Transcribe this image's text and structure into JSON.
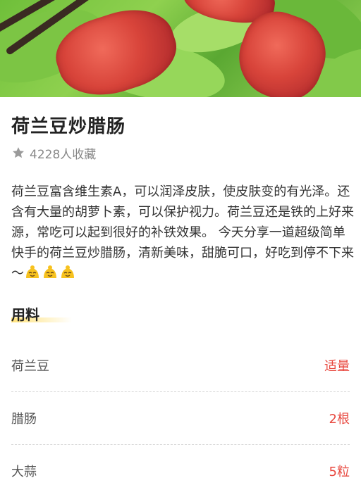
{
  "recipe": {
    "title": "荷兰豆炒腊肠",
    "favorites": "4228人收藏",
    "description": "荷兰豆富含维生素A，可以润泽皮肤，使皮肤变的有光泽。还含有大量的胡萝卜素，可以保护视力。荷兰豆还是铁的上好来源，常吃可以起到很好的补铁效果。 今天分享一道超级简单快手的荷兰豆炒腊肠，清新美味，甜脆可口，好吃到停不下来～"
  },
  "ingredients": {
    "section_title": "用料",
    "items": [
      {
        "name": "荷兰豆",
        "qty": "适量"
      },
      {
        "name": "腊肠",
        "qty": "2根"
      },
      {
        "name": "大蒜",
        "qty": "5粒"
      }
    ]
  },
  "colors": {
    "accent_red": "#e8483f",
    "underline_yellow": "#ffe27a"
  },
  "icons": {
    "favorite": "star-icon",
    "emoji": "smiling-face-emoji"
  }
}
